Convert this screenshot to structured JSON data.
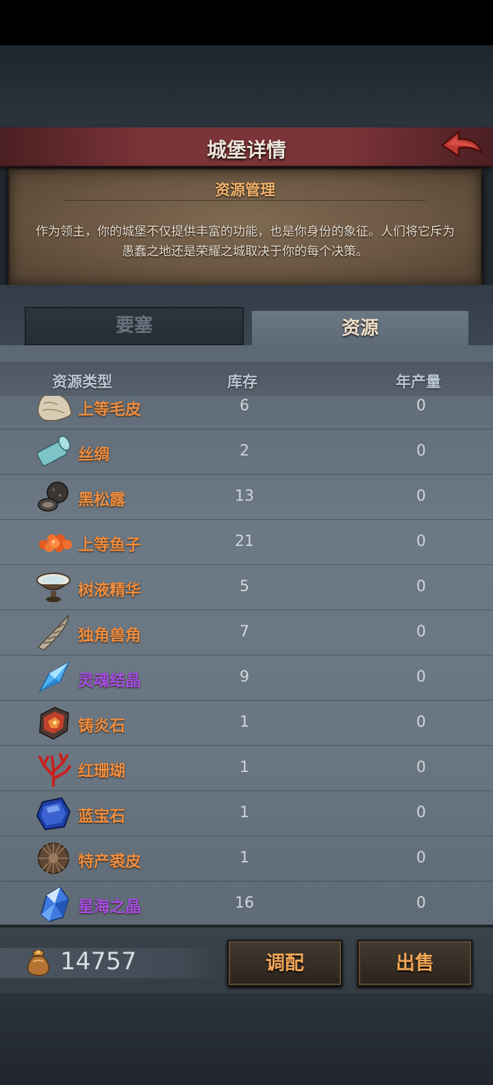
{
  "header": {
    "title": "城堡详情"
  },
  "info": {
    "title": "资源管理",
    "text": "作为领主，你的城堡不仅提供丰富的功能，也是你身份的象征。人们将它斥为愚蠢之地还是荣耀之城取决于你的每个决策。"
  },
  "tabs": [
    {
      "label": "要塞",
      "active": false
    },
    {
      "label": "资源",
      "active": true
    }
  ],
  "table": {
    "headers": {
      "type": "资源类型",
      "stock": "库存",
      "yearly": "年产量"
    },
    "rows": [
      {
        "icon": "fur-icon",
        "name": "上等毛皮",
        "stock": "6",
        "yearly": "0",
        "color": "#ee8d40"
      },
      {
        "icon": "silk-icon",
        "name": "丝绸",
        "stock": "2",
        "yearly": "0",
        "color": "#ee8d40"
      },
      {
        "icon": "truffle-icon",
        "name": "黑松露",
        "stock": "13",
        "yearly": "0",
        "color": "#ee8d40"
      },
      {
        "icon": "caviar-icon",
        "name": "上等鱼子",
        "stock": "21",
        "yearly": "0",
        "color": "#ee8d40"
      },
      {
        "icon": "sap-essence-icon",
        "name": "树液精华",
        "stock": "5",
        "yearly": "0",
        "color": "#ee8d40"
      },
      {
        "icon": "unicorn-horn-icon",
        "name": "独角兽角",
        "stock": "7",
        "yearly": "0",
        "color": "#ee8d40"
      },
      {
        "icon": "soul-crystal-icon",
        "name": "灵魂结晶",
        "stock": "9",
        "yearly": "0",
        "color": "#a64fe6"
      },
      {
        "icon": "flame-stone-icon",
        "name": "铸炎石",
        "stock": "1",
        "yearly": "0",
        "color": "#ee8d40"
      },
      {
        "icon": "red-coral-icon",
        "name": "红珊瑚",
        "stock": "1",
        "yearly": "0",
        "color": "#ee8d40"
      },
      {
        "icon": "sapphire-icon",
        "name": "蓝宝石",
        "stock": "1",
        "yearly": "0",
        "color": "#ee8d40"
      },
      {
        "icon": "special-pelt-icon",
        "name": "特产裘皮",
        "stock": "1",
        "yearly": "0",
        "color": "#ee8d40"
      },
      {
        "icon": "star-sea-crystal-icon",
        "name": "星海之晶",
        "stock": "16",
        "yearly": "0",
        "color": "#a64fe6"
      }
    ]
  },
  "footer": {
    "gold": "14757",
    "allocate_label": "调配",
    "sell_label": "出售"
  }
}
